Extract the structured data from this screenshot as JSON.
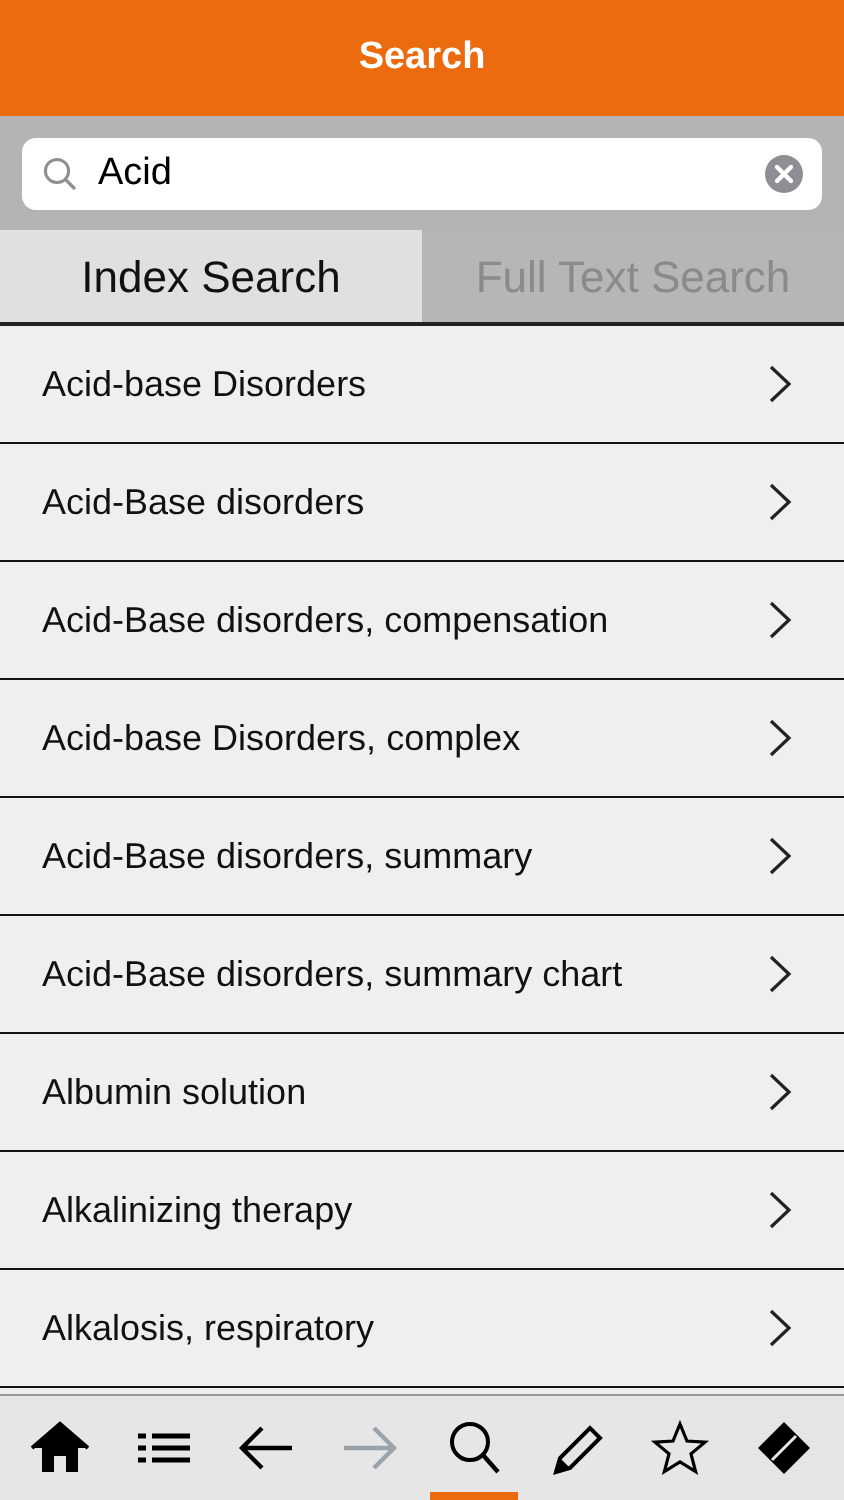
{
  "header": {
    "title": "Search"
  },
  "search": {
    "value": "Acid"
  },
  "tabs": [
    {
      "label": "Index Search",
      "selected": true
    },
    {
      "label": "Full Text Search",
      "selected": false
    }
  ],
  "results": [
    {
      "label": "Acid-base Disorders"
    },
    {
      "label": "Acid-Base disorders"
    },
    {
      "label": "Acid-Base disorders, compensation"
    },
    {
      "label": "Acid-base Disorders, complex"
    },
    {
      "label": "Acid-Base disorders, summary"
    },
    {
      "label": "Acid-Base disorders, summary chart"
    },
    {
      "label": "Albumin solution"
    },
    {
      "label": "Alkalinizing therapy"
    },
    {
      "label": "Alkalosis, respiratory"
    }
  ],
  "toolbar": [
    {
      "kind": "home",
      "selected": false,
      "disabled": false
    },
    {
      "kind": "list",
      "selected": false,
      "disabled": false
    },
    {
      "kind": "back",
      "selected": false,
      "disabled": false
    },
    {
      "kind": "forward",
      "selected": false,
      "disabled": true
    },
    {
      "kind": "search",
      "selected": true,
      "disabled": false
    },
    {
      "kind": "pencil",
      "selected": false,
      "disabled": false
    },
    {
      "kind": "star",
      "selected": false,
      "disabled": false
    },
    {
      "kind": "eraser",
      "selected": false,
      "disabled": false
    }
  ]
}
